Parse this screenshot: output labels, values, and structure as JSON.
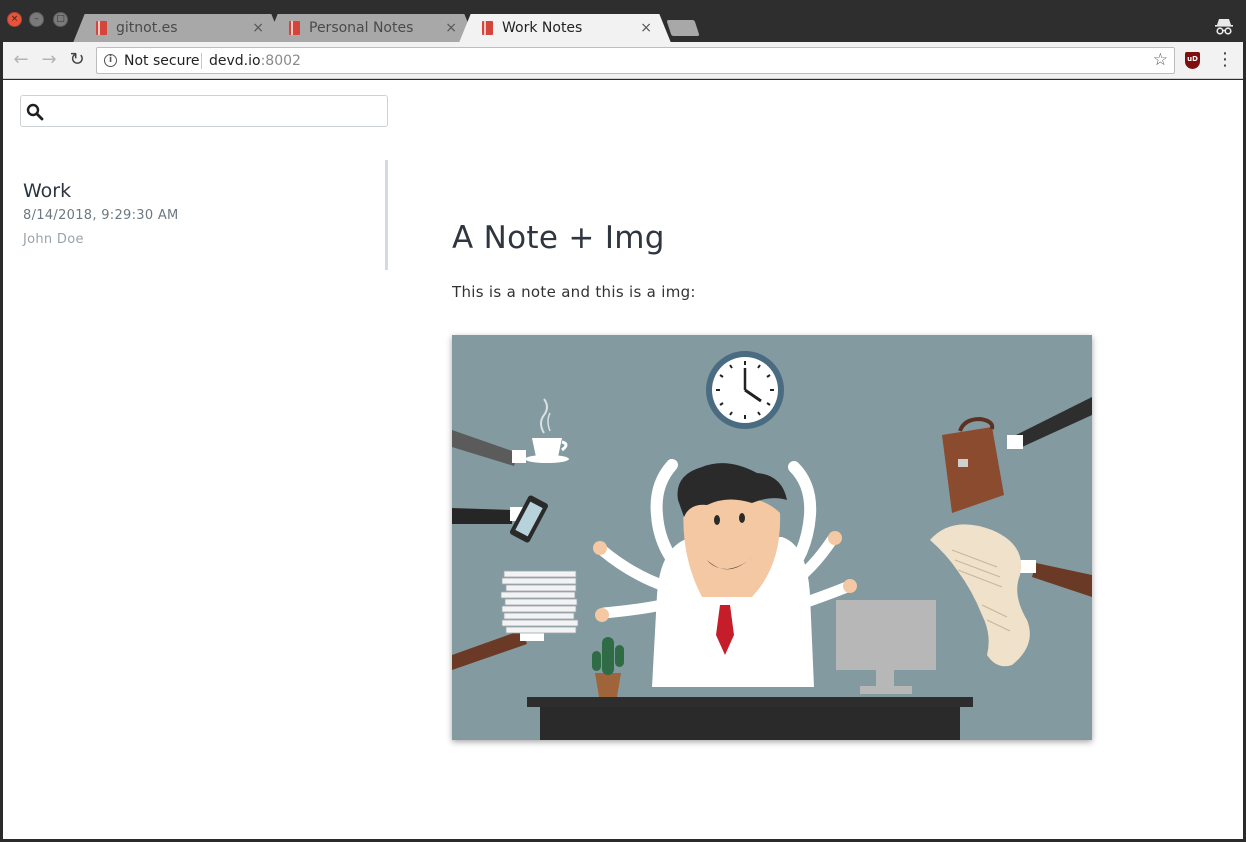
{
  "window": {
    "close_glyph": "×",
    "minimize_glyph": "–",
    "maximize_glyph": "□"
  },
  "tabs": [
    {
      "title": "gitnot.es",
      "close": "×",
      "active": false
    },
    {
      "title": "Personal Notes",
      "close": "×",
      "active": false
    },
    {
      "title": "Work Notes",
      "close": "×",
      "active": true
    }
  ],
  "toolbar": {
    "back_glyph": "←",
    "forward_glyph": "→",
    "reload_glyph": "↻",
    "security_label": "Not secure",
    "url_host": "devd.io",
    "url_port": ":8002",
    "star_glyph": "☆",
    "extension_label": "uD",
    "menu_glyph": "⋮"
  },
  "sidebar": {
    "search": {
      "value": "",
      "placeholder": ""
    },
    "notes": [
      {
        "title": "Work",
        "date": "8/14/2018, 9:29:30 AM",
        "author": "John Doe"
      }
    ]
  },
  "note": {
    "heading": "A Note + Img",
    "body": "This is a note and this is a img:"
  },
  "colors": {
    "image_background": "#839aa1",
    "sidebar_active_border": "#d3dbe1",
    "favicon": "#d4463b"
  },
  "icons": {
    "tab_favicon": "notebook-icon",
    "incognito": "incognito-icon",
    "search": "magnifier-icon"
  }
}
